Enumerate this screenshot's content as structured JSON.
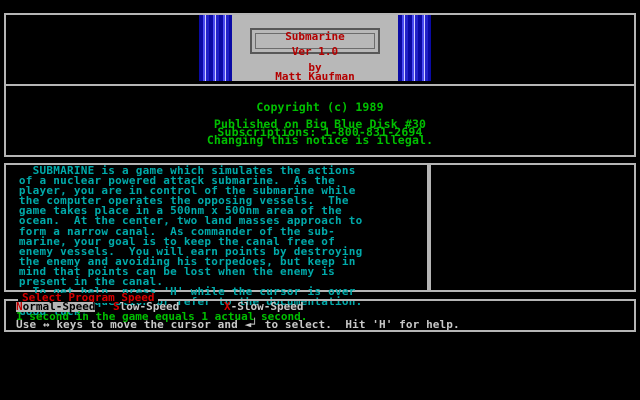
{
  "title_card": {
    "title": "Submarine",
    "version": "Ver 1.0",
    "by": "by",
    "author": "Matt Kaufman"
  },
  "info": {
    "copyright": "Copyright (c) 1989",
    "published": "Published on Big Blue Disk #30",
    "subscriptions": "Subscriptions: 1-800-831-2694",
    "notice": "Changing this notice is illegal."
  },
  "description": "   SUBMARINE is a game which simulates the actions\n of a nuclear powered attack submarine.  As the\n player, you are in control of the submarine while\n the computer operates the opposing vessels.  The\n game takes place in a 500nm x 500nm area of the\n ocean.  At the center, two land masses approach to\n form a narrow canal.  As commander of the sub-\n marine, your goal is to keep the canal free of\n enemy vessels.  You will earn points by destroying\n the enemy and avoiding his torpedoes, but keep in\n mind that points can be lost when the enemy is\n present in the canal.\n   To get help, press 'H' while the cursor is over\n command in question or refer to the documentation.\n Good luck!",
  "speed_panel": {
    "title": "Select Program Speed",
    "options": [
      {
        "hotkey": "N",
        "rest": "ormal-Speed",
        "selected": true
      },
      {
        "hotkey": "S",
        "rest": "low-Speed",
        "selected": false
      },
      {
        "hotkey": "X",
        "rest": "-Slow-Speed",
        "selected": false
      }
    ],
    "info_line": "1 second in the game equals 1 actual second.",
    "help_line": "Use ↔ keys to move the cursor and ◄┘ to select.  Hit 'H' for help."
  },
  "colors": {
    "border": "#b5b5b5",
    "green": "#00c000",
    "cyan": "#00aaaa",
    "red": "#d80000",
    "card": "#b8b8b8",
    "stripe_blue": "#1a1ab8"
  }
}
